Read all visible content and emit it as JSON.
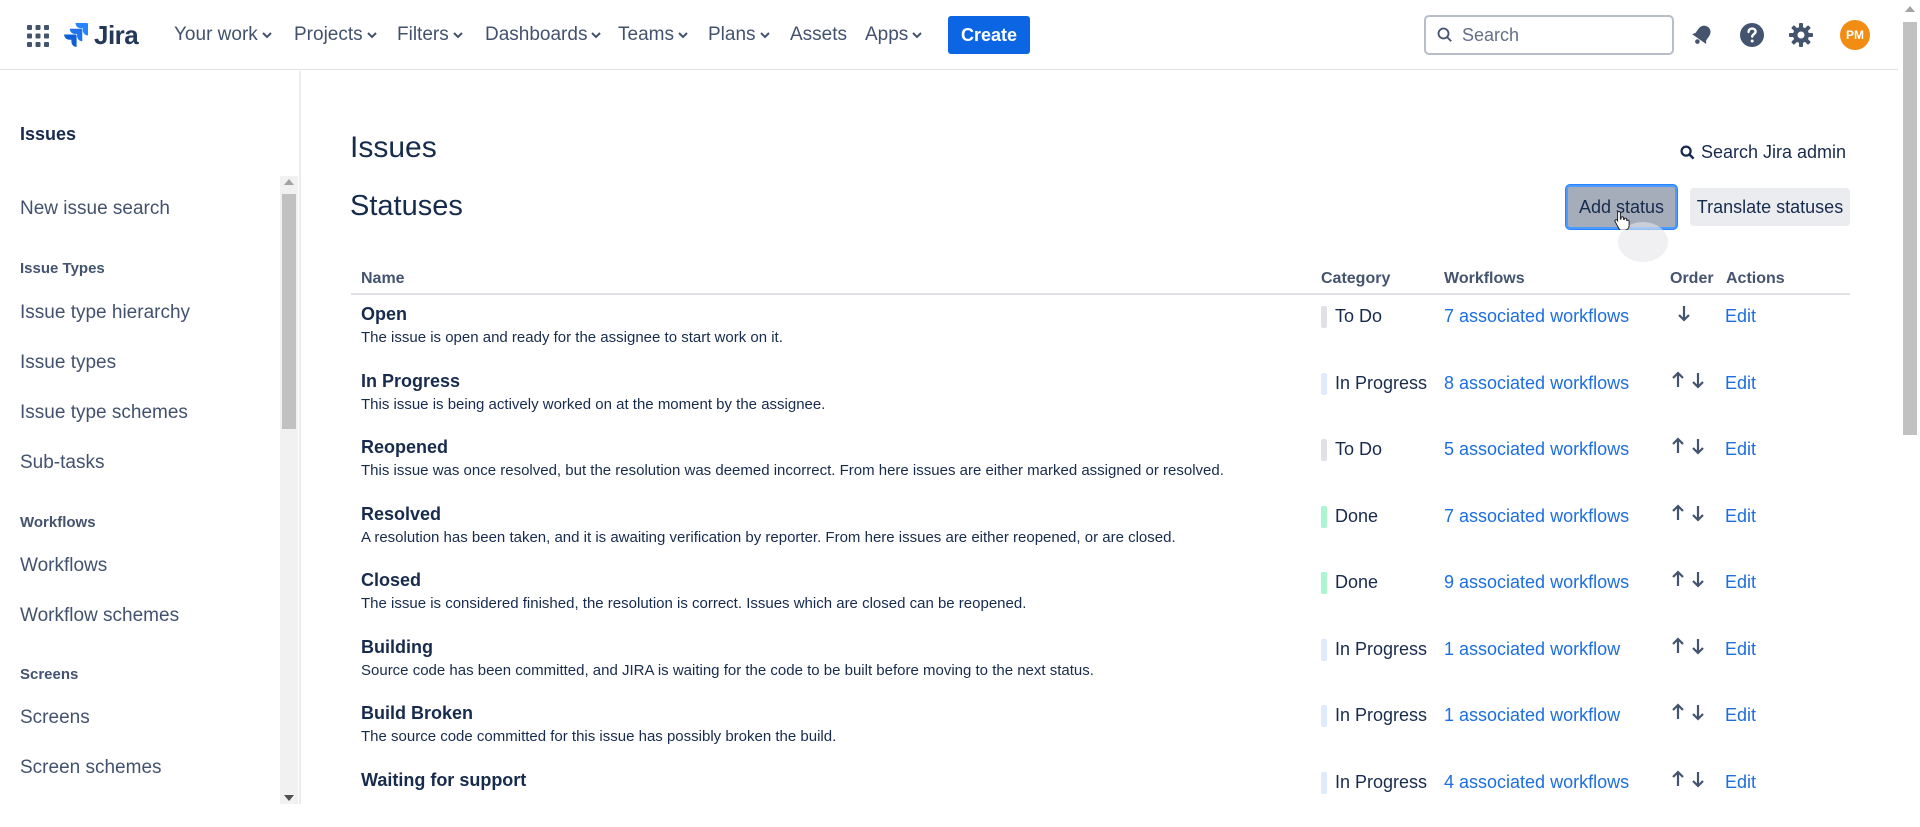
{
  "topnav": {
    "logo_text": "Jira",
    "items": [
      {
        "label": "Your work"
      },
      {
        "label": "Projects"
      },
      {
        "label": "Filters"
      },
      {
        "label": "Dashboards"
      },
      {
        "label": "Teams"
      },
      {
        "label": "Plans"
      },
      {
        "label": "Assets"
      },
      {
        "label": "Apps"
      }
    ],
    "create_label": "Create",
    "search_placeholder": "Search",
    "avatar_initials": "PM",
    "icons": [
      "app-switcher-icon",
      "notifications-icon",
      "help-icon",
      "settings-icon"
    ]
  },
  "sidebar": {
    "header": "Issues",
    "items": [
      {
        "type": "link",
        "label": "New issue search"
      },
      {
        "type": "section",
        "label": "Issue Types"
      },
      {
        "type": "link",
        "label": "Issue type hierarchy"
      },
      {
        "type": "link",
        "label": "Issue types"
      },
      {
        "type": "link",
        "label": "Issue type schemes"
      },
      {
        "type": "link",
        "label": "Sub-tasks"
      },
      {
        "type": "section",
        "label": "Workflows"
      },
      {
        "type": "link",
        "label": "Workflows"
      },
      {
        "type": "link",
        "label": "Workflow schemes"
      },
      {
        "type": "section",
        "label": "Screens"
      },
      {
        "type": "link",
        "label": "Screens"
      },
      {
        "type": "link",
        "label": "Screen schemes"
      }
    ]
  },
  "main": {
    "page_title": "Issues",
    "section_title": "Statuses",
    "admin_search_label": "Search Jira admin",
    "add_status_label": "Add status",
    "translate_label": "Translate statuses",
    "columns": {
      "name": "Name",
      "category": "Category",
      "workflows": "Workflows",
      "order": "Order",
      "actions": "Actions"
    },
    "category_colors": {
      "To Do": "#dfe1e6",
      "In Progress": "#deebff",
      "Done": "#abf5d1"
    },
    "rows": [
      {
        "name": "Open",
        "description": "The issue is open and ready for the assignee to start work on it.",
        "category": "To Do",
        "workflows": "7 associated workflows",
        "up": false,
        "down": true,
        "edit": "Edit"
      },
      {
        "name": "In Progress",
        "description": "This issue is being actively worked on at the moment by the assignee.",
        "category": "In Progress",
        "workflows": "8 associated workflows",
        "up": true,
        "down": true,
        "edit": "Edit"
      },
      {
        "name": "Reopened",
        "description": "This issue was once resolved, but the resolution was deemed incorrect. From here issues are either marked assigned or resolved.",
        "category": "To Do",
        "workflows": "5 associated workflows",
        "up": true,
        "down": true,
        "edit": "Edit"
      },
      {
        "name": "Resolved",
        "description": "A resolution has been taken, and it is awaiting verification by reporter. From here issues are either reopened, or are closed.",
        "category": "Done",
        "workflows": "7 associated workflows",
        "up": true,
        "down": true,
        "edit": "Edit"
      },
      {
        "name": "Closed",
        "description": "The issue is considered finished, the resolution is correct. Issues which are closed can be reopened.",
        "category": "Done",
        "workflows": "9 associated workflows",
        "up": true,
        "down": true,
        "edit": "Edit"
      },
      {
        "name": "Building",
        "description": "Source code has been committed, and JIRA is waiting for the code to be built before moving to the next status.",
        "category": "In Progress",
        "workflows": "1 associated workflow",
        "up": true,
        "down": true,
        "edit": "Edit"
      },
      {
        "name": "Build Broken",
        "description": "The source code committed for this issue has possibly broken the build.",
        "category": "In Progress",
        "workflows": "1 associated workflow",
        "up": true,
        "down": true,
        "edit": "Edit"
      },
      {
        "name": "Waiting for support",
        "description": "",
        "category": "In Progress",
        "workflows": "4 associated workflows",
        "up": true,
        "down": true,
        "edit": "Edit"
      }
    ]
  }
}
